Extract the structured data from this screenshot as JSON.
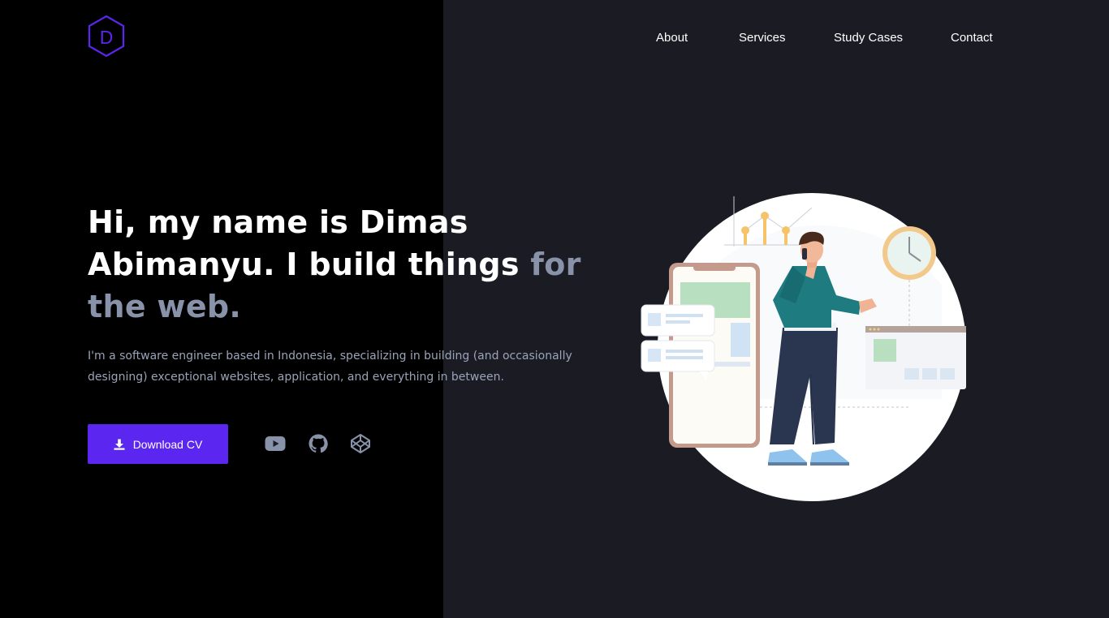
{
  "logo": {
    "letter": "D",
    "color": "#5b26f0"
  },
  "nav": {
    "items": [
      {
        "label": "About"
      },
      {
        "label": "Services"
      },
      {
        "label": "Study Cases"
      },
      {
        "label": "Contact"
      }
    ]
  },
  "hero": {
    "title_main": "Hi, my name is Dimas Abimanyu. I build things ",
    "title_muted": "for the web.",
    "description": "I'm a software engineer based in Indonesia, specializing in building (and occasionally designing) exceptional websites, application, and everything in between.",
    "cta_label": "Download CV",
    "cta_icon": "download-icon",
    "accent_color": "#5b26f0"
  },
  "social": [
    {
      "name": "youtube-icon"
    },
    {
      "name": "github-icon"
    },
    {
      "name": "codepen-icon"
    }
  ],
  "colors": {
    "left_panel": "#000000",
    "right_panel": "#1b1b24",
    "muted_text": "#8892a8"
  }
}
